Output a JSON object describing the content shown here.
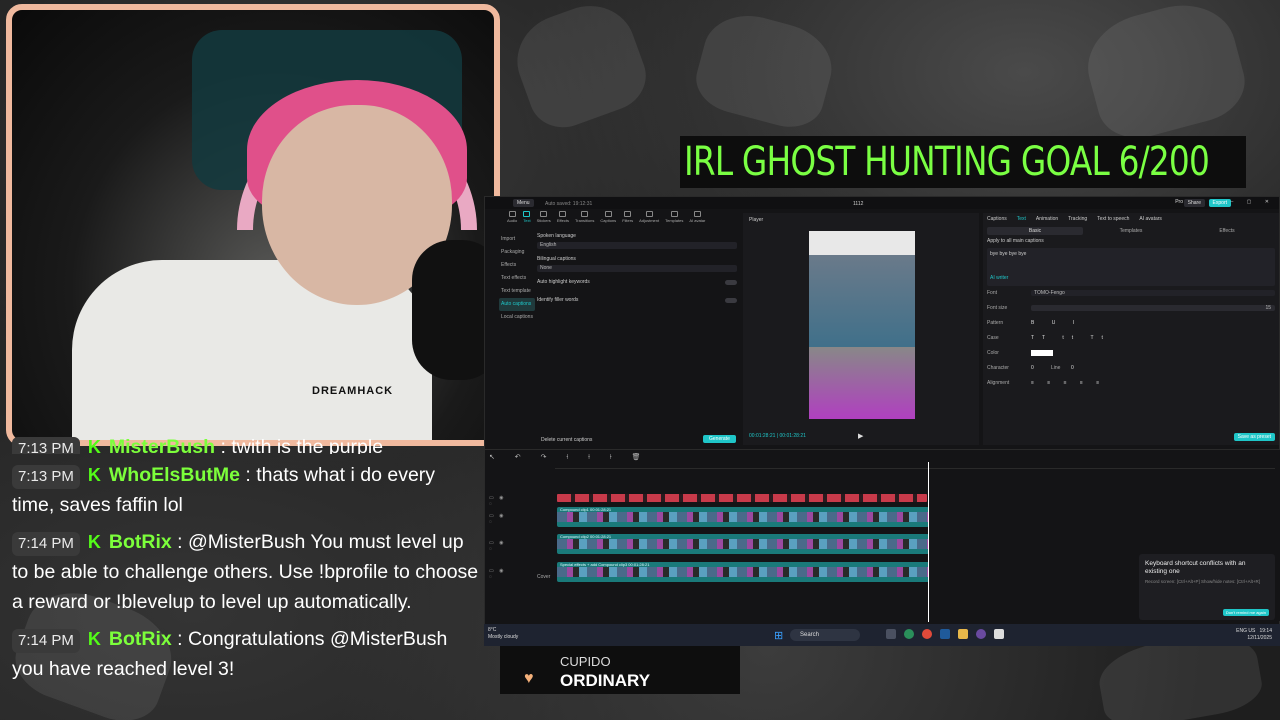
{
  "goal": {
    "text": "IRL GHOST HUNTING GOAL   6/200"
  },
  "chat": {
    "partial": {
      "time": "7:13 PM",
      "user": "MisterBush",
      "text": " : twith is the purple"
    },
    "messages": [
      {
        "time": "7:13 PM",
        "user": "WhoElsButMe",
        "text": " : thats what i do every time, saves faffin lol"
      },
      {
        "time": "7:14 PM",
        "user": "BotRix",
        "text": " : @MisterBush You must level up to be able to challenge others. Use !bprofile to choose a reward or !blevelup to level up automatically."
      },
      {
        "time": "7:14 PM",
        "user": "BotRix",
        "text": " : Congratulations @MisterBush you have reached level 3!"
      }
    ]
  },
  "webcam": {
    "shirt_text": "DREAMHACK"
  },
  "capcut": {
    "menu": "Menu",
    "autosave": "Auto saved: 19:12:31",
    "project": "1112",
    "pro": "Pro",
    "share": "Share",
    "export": "Export",
    "toolbar": [
      "Audio",
      "Text",
      "Stickers",
      "Effects",
      "Transitions",
      "Captions",
      "Filters",
      "Adjustment",
      "Templates",
      "AI avatar"
    ],
    "side": [
      "Import",
      "Packaging",
      "Effects",
      "Text effects",
      "Text template",
      "Auto captions",
      "Local captions"
    ],
    "left": {
      "spoken_language_label": "Spoken language",
      "spoken_language": "English",
      "bilingual_label": "Bilingual captions",
      "bilingual": "None",
      "auto_highlight": "Auto highlight keywords",
      "identify_filler": "Identify filler words",
      "delete_captions": "Delete current captions",
      "generate": "Generate"
    },
    "player": {
      "title": "Player",
      "time": "00:01:28:21  |  00:01:28:21"
    },
    "right": {
      "tabs": [
        "Captions",
        "Text",
        "Animation",
        "Tracking",
        "Text to speech",
        "AI avatars"
      ],
      "subtabs": [
        "Basic",
        "Templates",
        "Effects"
      ],
      "apply_all": "Apply to all main captions",
      "text": "bye bye bye bye",
      "ai_writer": "AI writer",
      "font_label": "Font",
      "font": "TOMO-Fengo",
      "font_size_label": "Font size",
      "font_size": "15",
      "pattern_label": "Pattern",
      "case_label": "Case",
      "color_label": "Color",
      "character_label": "Character",
      "character": "0",
      "line_label": "Line",
      "line": "0",
      "alignment_label": "Alignment",
      "save_preset": "Save as preset"
    },
    "timeline": {
      "track_labels": [
        "Compound clip1  00:01:28:21",
        "Compound clip2  00:01:28:21",
        "Special effects + add  Compound clip3  00:01:28:21"
      ],
      "cover": "Cover"
    },
    "toast": {
      "title": "Keyboard shortcut conflicts with an existing one",
      "detail": "Record screen: [Ctrl+Alt+P]  Show/hide notes: [Ctrl+Alt+R]",
      "button": "Don't remind me again"
    }
  },
  "taskbar": {
    "weather_temp": "8°C",
    "weather_desc": "Mostly cloudy",
    "search": "Search",
    "lang": "ENG US",
    "time": "19:14",
    "date": "12/11/2025"
  },
  "now_playing": {
    "artist": "CUPIDO",
    "title": "ORDINARY"
  },
  "colors": {
    "accent": "#1fc6c8",
    "kick_green": "#53fc18",
    "goal_green": "#7aff43",
    "frame": "#f0b99e"
  }
}
